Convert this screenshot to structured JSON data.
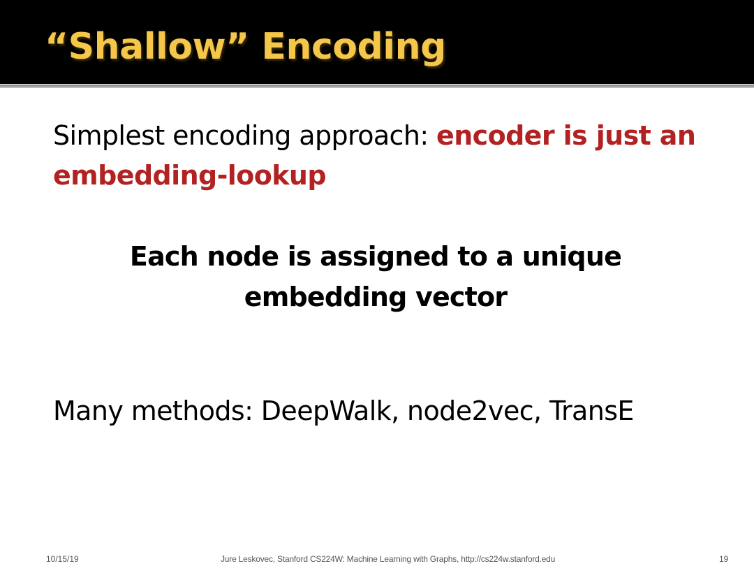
{
  "slide": {
    "title": "“Shallow” Encoding",
    "paragraphs": {
      "first_plain": "Simplest encoding approach: ",
      "first_highlight": "encoder is just an embedding-lookup",
      "second": "Each node is assigned to a unique embedding vector",
      "third": "Many methods: DeepWalk, node2vec, TransE"
    },
    "footer": {
      "date": "10/15/19",
      "credit": "Jure Leskovec, Stanford CS224W: Machine Learning with Graphs, http://cs224w.stanford.edu",
      "page": "19"
    }
  },
  "colors": {
    "title": "#f4c64a",
    "header_background": "#000000",
    "highlight": "#b22222",
    "body_text": "#000000"
  }
}
